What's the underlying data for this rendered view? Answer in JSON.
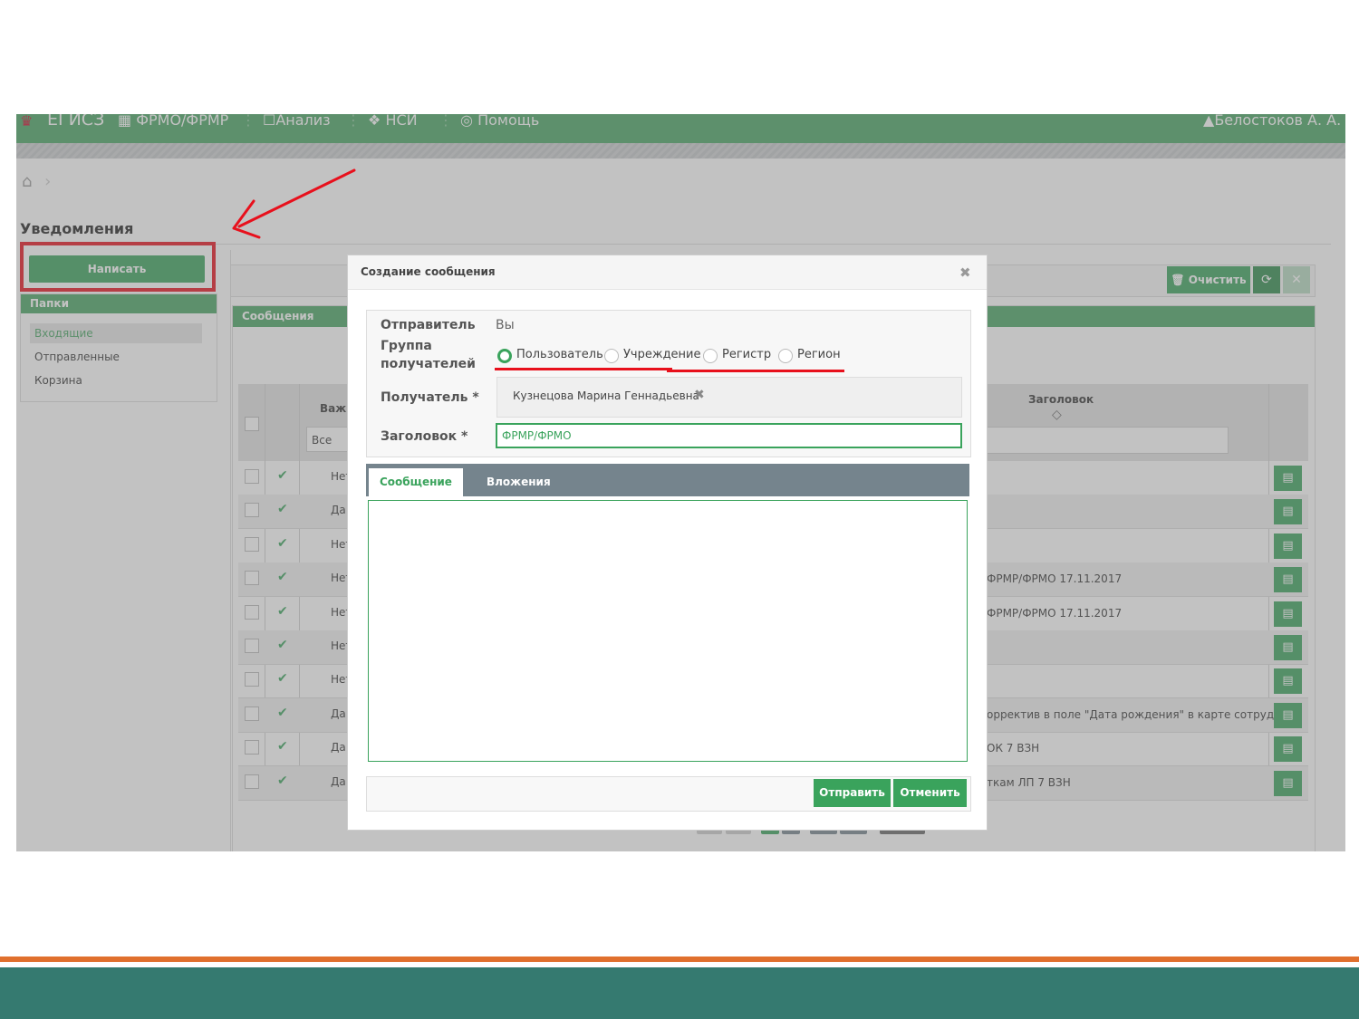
{
  "topbar": {
    "logo": "ЕГИСЗ",
    "menu": [
      "ФРМО/ФРМР",
      "Анализ",
      "НСИ",
      "Помощь"
    ],
    "user": "Белостоков А. А."
  },
  "breadcrumb": {
    "current": ""
  },
  "page": {
    "title": "Уведомления"
  },
  "compose_label": "Написать",
  "folders": {
    "header": "Папки",
    "items": [
      "Входящие",
      "Отправленные",
      "Корзина"
    ],
    "active": "Входящие"
  },
  "toolbar": {
    "clear_label": "Очистить"
  },
  "messages": {
    "header": "Сообщения",
    "columns": {
      "importance": "Важн",
      "title": "Заголовок"
    },
    "importance_filter": "Все",
    "rows": [
      {
        "importance": "Нет",
        "title": ""
      },
      {
        "importance": "Да",
        "title": ""
      },
      {
        "importance": "Нет",
        "title": ""
      },
      {
        "importance": "Нет",
        "title": "ФРМР/ФРМО 17.11.2017"
      },
      {
        "importance": "Нет",
        "title": "ФРМР/ФРМО 17.11.2017"
      },
      {
        "importance": "Нет",
        "title": ""
      },
      {
        "importance": "Нет",
        "title": ""
      },
      {
        "importance": "Да",
        "title": "орректив в поле \"Дата рождения\" в карте сотрудника"
      },
      {
        "importance": "Да",
        "title": "ОК 7 ВЗН"
      },
      {
        "importance": "Да",
        "title": "ткам ЛП 7 ВЗН"
      }
    ]
  },
  "modal": {
    "title": "Создание сообщения",
    "sender_label": "Отправитель",
    "sender_value": "Вы",
    "group_label_1": "Группа",
    "group_label_2": "получателей",
    "groups": [
      "Пользователь",
      "Учреждение",
      "Регистр",
      "Регион"
    ],
    "selected_group": "Пользователь",
    "recipient_label": "Получатель *",
    "recipient_value": "Кузнецова Марина Геннадьевна",
    "subject_label": "Заголовок *",
    "subject_value": "ФРМР/ФРМО",
    "tabs": [
      "Сообщение",
      "Вложения"
    ],
    "active_tab": "Сообщение",
    "body": "",
    "send_label": "Отправить",
    "cancel_label": "Отменить"
  },
  "colors": {
    "brand_green": "#48a463",
    "button_green": "#3aa35c",
    "annotation_red": "#e8101c",
    "footer_orange": "#e0702e",
    "footer_teal": "#357a70"
  }
}
